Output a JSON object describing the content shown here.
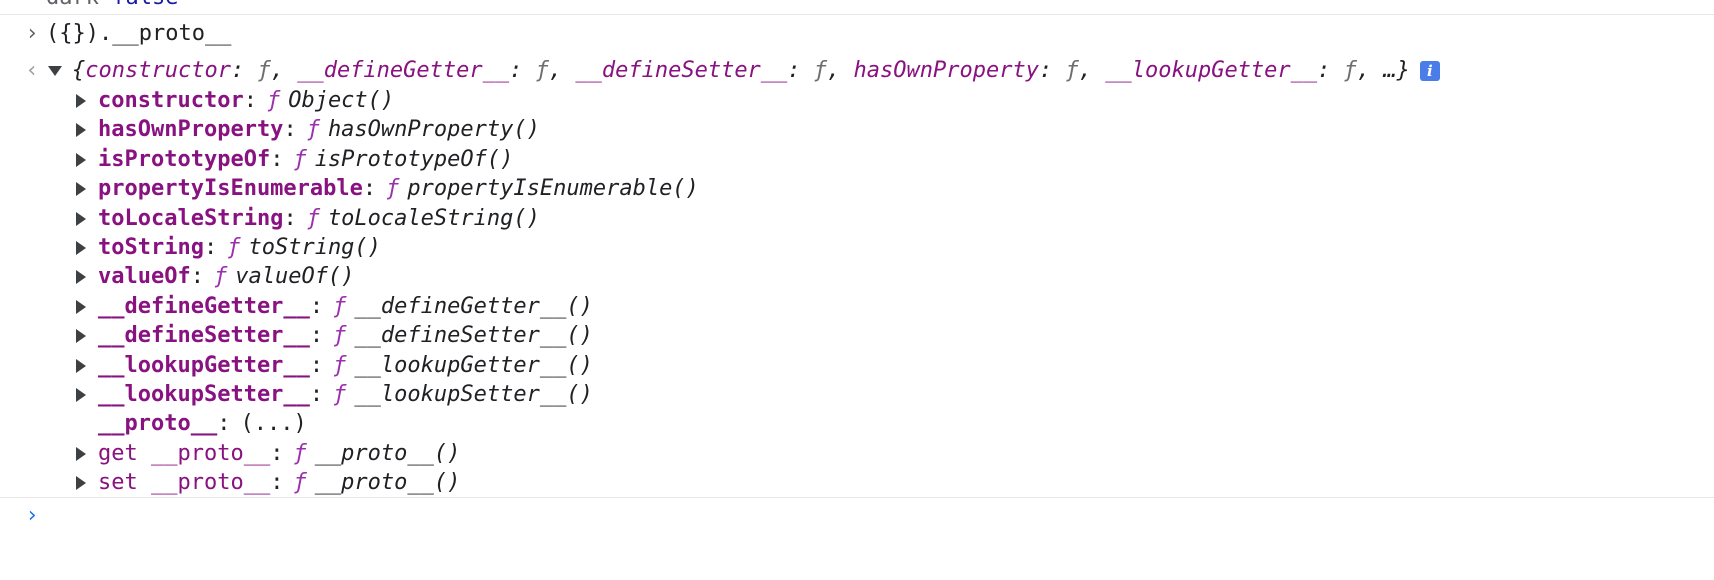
{
  "previous_output": {
    "name": "dark",
    "value": "false"
  },
  "input": {
    "command": "({}).__proto__"
  },
  "result": {
    "summary_open": "{",
    "summary_pairs": [
      {
        "key": "constructor",
        "val": "ƒ"
      },
      {
        "key": "__defineGetter__",
        "val": "ƒ"
      },
      {
        "key": "__defineSetter__",
        "val": "ƒ"
      },
      {
        "key": "hasOwnProperty",
        "val": "ƒ"
      },
      {
        "key": "__lookupGetter__",
        "val": "ƒ"
      }
    ],
    "summary_tail": "…}",
    "info_icon": "i",
    "properties": [
      {
        "name": "constructor",
        "fsym": "ƒ",
        "value": "Object()"
      },
      {
        "name": "hasOwnProperty",
        "fsym": "ƒ",
        "value": "hasOwnProperty()"
      },
      {
        "name": "isPrototypeOf",
        "fsym": "ƒ",
        "value": "isPrototypeOf()"
      },
      {
        "name": "propertyIsEnumerable",
        "fsym": "ƒ",
        "value": "propertyIsEnumerable()"
      },
      {
        "name": "toLocaleString",
        "fsym": "ƒ",
        "value": "toLocaleString()"
      },
      {
        "name": "toString",
        "fsym": "ƒ",
        "value": "toString()"
      },
      {
        "name": "valueOf",
        "fsym": "ƒ",
        "value": "valueOf()"
      },
      {
        "name": "__defineGetter__",
        "fsym": "ƒ",
        "value": "__defineGetter__()"
      },
      {
        "name": "__defineSetter__",
        "fsym": "ƒ",
        "value": "__defineSetter__()"
      },
      {
        "name": "__lookupGetter__",
        "fsym": "ƒ",
        "value": "__lookupGetter__()"
      },
      {
        "name": "__lookupSetter__",
        "fsym": "ƒ",
        "value": "__lookupSetter__()"
      }
    ],
    "proto_line": {
      "name": "__proto__",
      "value": "(...)"
    },
    "accessors": [
      {
        "name": "get __proto__",
        "fsym": "ƒ",
        "value": "__proto__()"
      },
      {
        "name": "set __proto__",
        "fsym": "ƒ",
        "value": "__proto__()"
      }
    ]
  },
  "icons": {
    "prompt": "chevron-right-icon",
    "return": "chevron-left-icon",
    "expand_open": "triangle-down-icon",
    "expand_closed": "triangle-right-icon",
    "info": "info-icon"
  },
  "colors": {
    "property_name": "#881280",
    "function_symbol": "#9b2fae",
    "active_prompt": "#1a73e8",
    "info_badge": "#4a7de8"
  }
}
